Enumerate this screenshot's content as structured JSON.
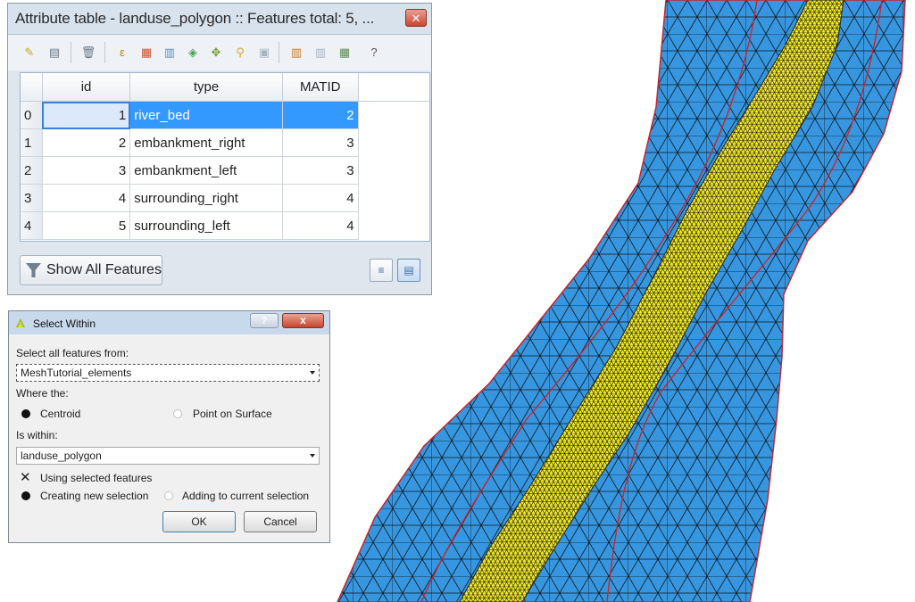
{
  "attribute_table": {
    "title": "Attribute table - landuse_polygon :: Features total: 5, ...",
    "columns": [
      "id",
      "type",
      "MATID"
    ],
    "rows": [
      {
        "row": "0",
        "id": "1",
        "type": "river_bed",
        "matid": "2"
      },
      {
        "row": "1",
        "id": "2",
        "type": "embankment_right",
        "matid": "3"
      },
      {
        "row": "2",
        "id": "3",
        "type": "embankment_left",
        "matid": "3"
      },
      {
        "row": "3",
        "id": "4",
        "type": "surrounding_right",
        "matid": "4"
      },
      {
        "row": "4",
        "id": "5",
        "type": "surrounding_left",
        "matid": "4"
      }
    ],
    "filter_label": "Show All Features",
    "toolbar_help": "?",
    "selected_row": 0
  },
  "select_within": {
    "title": "Select Within",
    "help_label": "?",
    "close_label": "x",
    "select_from_label": "Select all features from:",
    "select_from_value": "MeshTutorial_elements",
    "where_label": "Where the:",
    "centroid_label": "Centroid",
    "point_on_surface_label": "Point on Surface",
    "within_label": "Is within:",
    "within_value": "landuse_polygon",
    "using_selected_label": "Using selected features",
    "creating_new_label": "Creating new selection",
    "adding_label": "Adding to current selection",
    "ok_label": "OK",
    "cancel_label": "Cancel"
  },
  "map": {
    "colors": {
      "outer_area": "#3697e0",
      "river_bed": "#f2ea2a",
      "mesh_lines": "#111111",
      "boundary_lines": "#c8252c"
    }
  }
}
